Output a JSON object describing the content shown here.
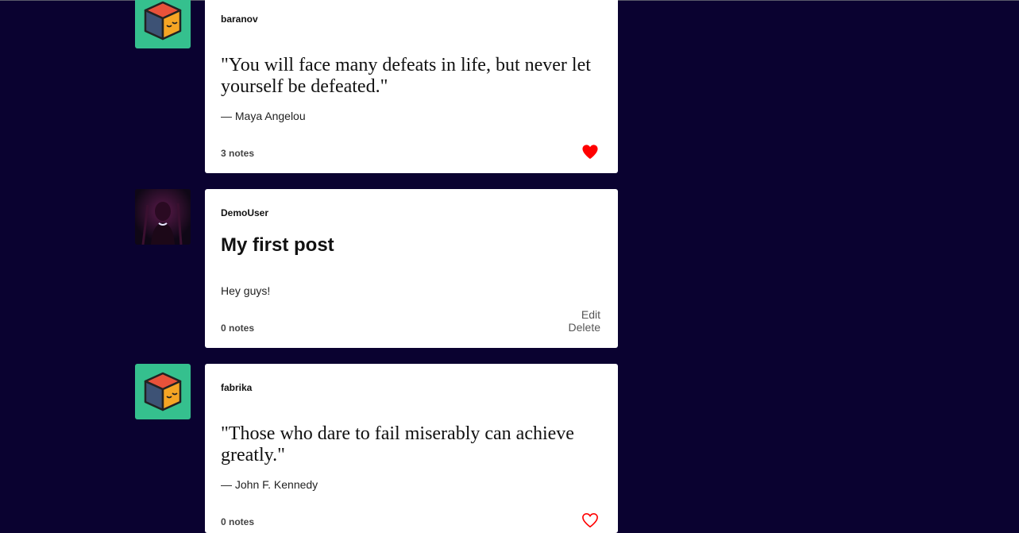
{
  "posts": [
    {
      "username": "baranov",
      "avatar": "cube-avatar",
      "type": "quote",
      "quote": "\"You will face many defeats in life, but never let yourself be defeated.\"",
      "source": "— Maya Angelou",
      "notes": "3 notes",
      "liked": true
    },
    {
      "username": "DemoUser",
      "avatar": "dark-figure-avatar",
      "type": "text",
      "title": "My first post",
      "body": "Hey guys!",
      "notes": "0 notes",
      "actions": {
        "edit": "Edit",
        "delete": "Delete"
      }
    },
    {
      "username": "fabrika",
      "avatar": "cube-avatar",
      "type": "quote",
      "quote": "\"Those who dare to fail miserably can achieve greatly.\"",
      "source": "— John F. Kennedy",
      "notes": "0 notes",
      "liked": false
    }
  ],
  "colors": {
    "background": "#0a0230",
    "card": "#ffffff",
    "avatar_green": "#35c08e",
    "like_red": "#ff0000"
  }
}
